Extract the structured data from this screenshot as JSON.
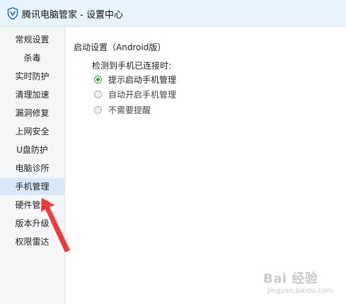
{
  "window": {
    "title": "腾讯电脑管家 - 设置中心",
    "icon": "shield-logo-icon",
    "title_bar_color": "#e8f4fc"
  },
  "sidebar": {
    "active_index": 8,
    "active_color": "#d9e8f8",
    "items": [
      {
        "label": "常规设置"
      },
      {
        "label": "杀毒"
      },
      {
        "label": "实时防护"
      },
      {
        "label": "清理加速"
      },
      {
        "label": "漏洞修复"
      },
      {
        "label": "上网安全"
      },
      {
        "label": "U盘防护"
      },
      {
        "label": "电脑诊所"
      },
      {
        "label": "手机管理"
      },
      {
        "label": "硬件管理"
      },
      {
        "label": "版本升级"
      },
      {
        "label": "权限雷达"
      }
    ]
  },
  "main": {
    "section_title": "启动设置（Android版）",
    "subtitle": "检测到手机已连接时:",
    "options": [
      {
        "label": "提示启动手机管理",
        "checked": true
      },
      {
        "label": "自动开启手机管理",
        "checked": false
      },
      {
        "label": "不需要提醒",
        "checked": false
      }
    ],
    "radio_checked_color": "#2e9e4d"
  },
  "annotation": {
    "icon": "red-arrow-icon",
    "color": "#f03a3a"
  },
  "watermark": {
    "main": "Bai 经验",
    "sub": "jingyan.baidu.com"
  }
}
